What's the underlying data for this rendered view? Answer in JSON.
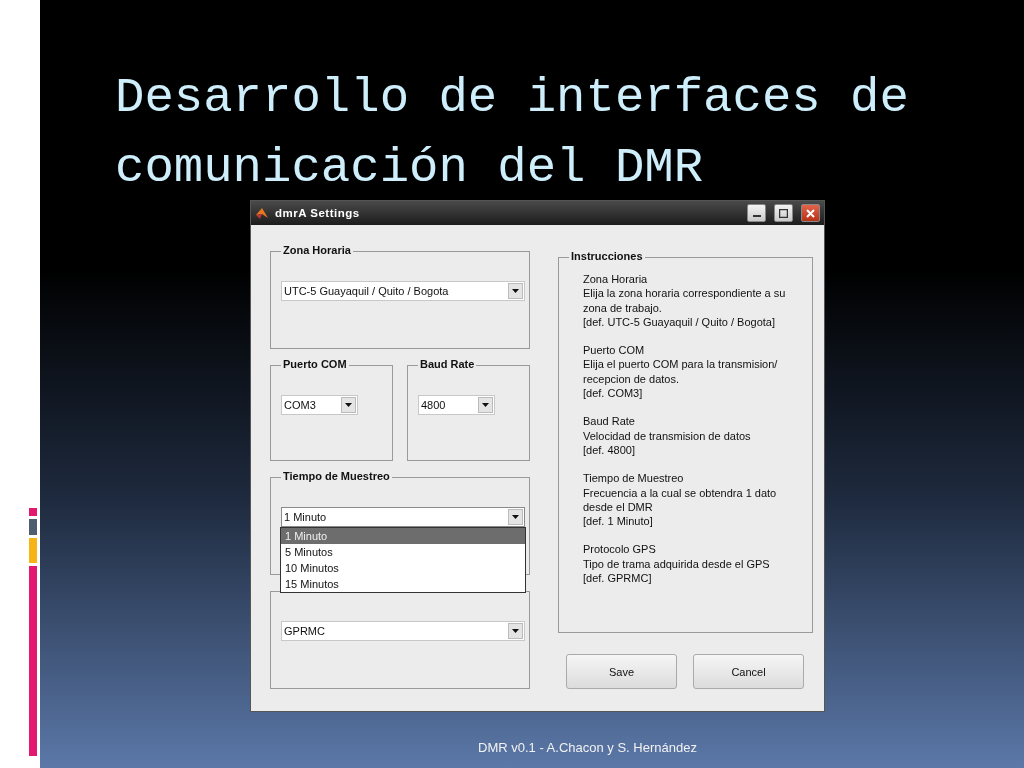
{
  "slide": {
    "title_lines": [
      "Desarrollo de interfaces de",
      "comunicación del DMR"
    ],
    "footer": "DMR v0.1 - A.Chacon y S. Hernández"
  },
  "window": {
    "title": "dmrA Settings"
  },
  "settings": [
    {
      "kind": "wide",
      "title": "Zona Horaria",
      "value": "UTC-5 Guayaquil / Quito / Bogota",
      "open": false
    },
    {
      "kind": "half",
      "title": "Puerto COM",
      "value": "COM3",
      "open": false
    },
    {
      "kind": "half",
      "title": "Baud Rate",
      "value": "4800",
      "open": false
    },
    {
      "kind": "wide",
      "title": "Tiempo de Muestreo",
      "value": "1 Minuto",
      "open": true,
      "options": [
        {
          "label": "1 Minuto",
          "selected": true
        },
        {
          "label": "5 Minutos",
          "selected": false
        },
        {
          "label": "10 Minutos",
          "selected": false
        },
        {
          "label": "15 Minutos",
          "selected": false
        }
      ]
    },
    {
      "kind": "wide",
      "value": "GPRMC",
      "open": false
    }
  ],
  "instructions": {
    "title": "Instrucciones",
    "sections": [
      [
        "Zona Horaria",
        "Elija la zona horaria correspondiente a su",
        "zona de trabajo.",
        "[def.  UTC-5 Guayaquil / Quito / Bogota]"
      ],
      [
        "Puerto COM",
        "Elija el puerto COM para la transmision/",
        "recepcion de datos.",
        "[def. COM3]"
      ],
      [
        "Baud Rate",
        "Velocidad de transmision de datos",
        "[def. 4800]"
      ],
      [
        "Tiempo de Muestreo",
        "Frecuencia a la cual se obtendra 1 dato",
        "desde el DMR",
        "[def. 1 Minuto]"
      ],
      [
        "Protocolo GPS",
        "Tipo de trama adquirida desde el GPS",
        "[def. GPRMC]"
      ]
    ]
  },
  "buttons": [
    "Save",
    "Cancel"
  ]
}
